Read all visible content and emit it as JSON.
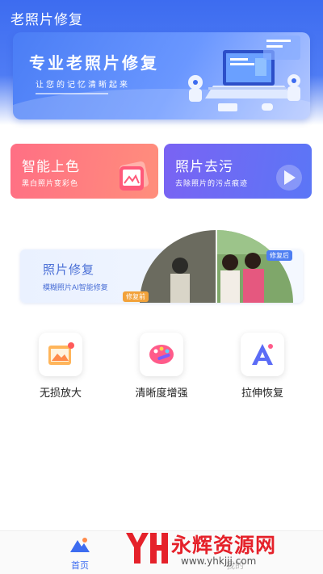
{
  "app": {
    "title": "老照片修复"
  },
  "banner": {
    "title": "专业老照片修复",
    "subtitle": "让您的记忆清晰起来"
  },
  "cards": [
    {
      "title": "智能上色",
      "subtitle": "黑白照片变彩色",
      "icon": "image-color-icon"
    },
    {
      "title": "照片去污",
      "subtitle": "去除照片的污点痕迹",
      "icon": "play-image-icon"
    }
  ],
  "restore": {
    "title": "照片修复",
    "subtitle": "模糊照片AI智能修复",
    "tag_before": "修复前",
    "tag_after": "修复后"
  },
  "tools": [
    {
      "label": "无损放大",
      "icon": "image-enlarge-icon"
    },
    {
      "label": "清晰度增强",
      "icon": "palette-icon"
    },
    {
      "label": "拉伸恢复",
      "icon": "stretch-icon"
    }
  ],
  "tabbar": {
    "home_label": "首页",
    "mine_label": "我的"
  },
  "watermark": {
    "text": "永辉资源网",
    "url": "www.yhkjjj.com"
  },
  "colors": {
    "primary": "#3d6cf0",
    "card_color": "#ff7482",
    "card_clean": "#6a6cf4"
  }
}
